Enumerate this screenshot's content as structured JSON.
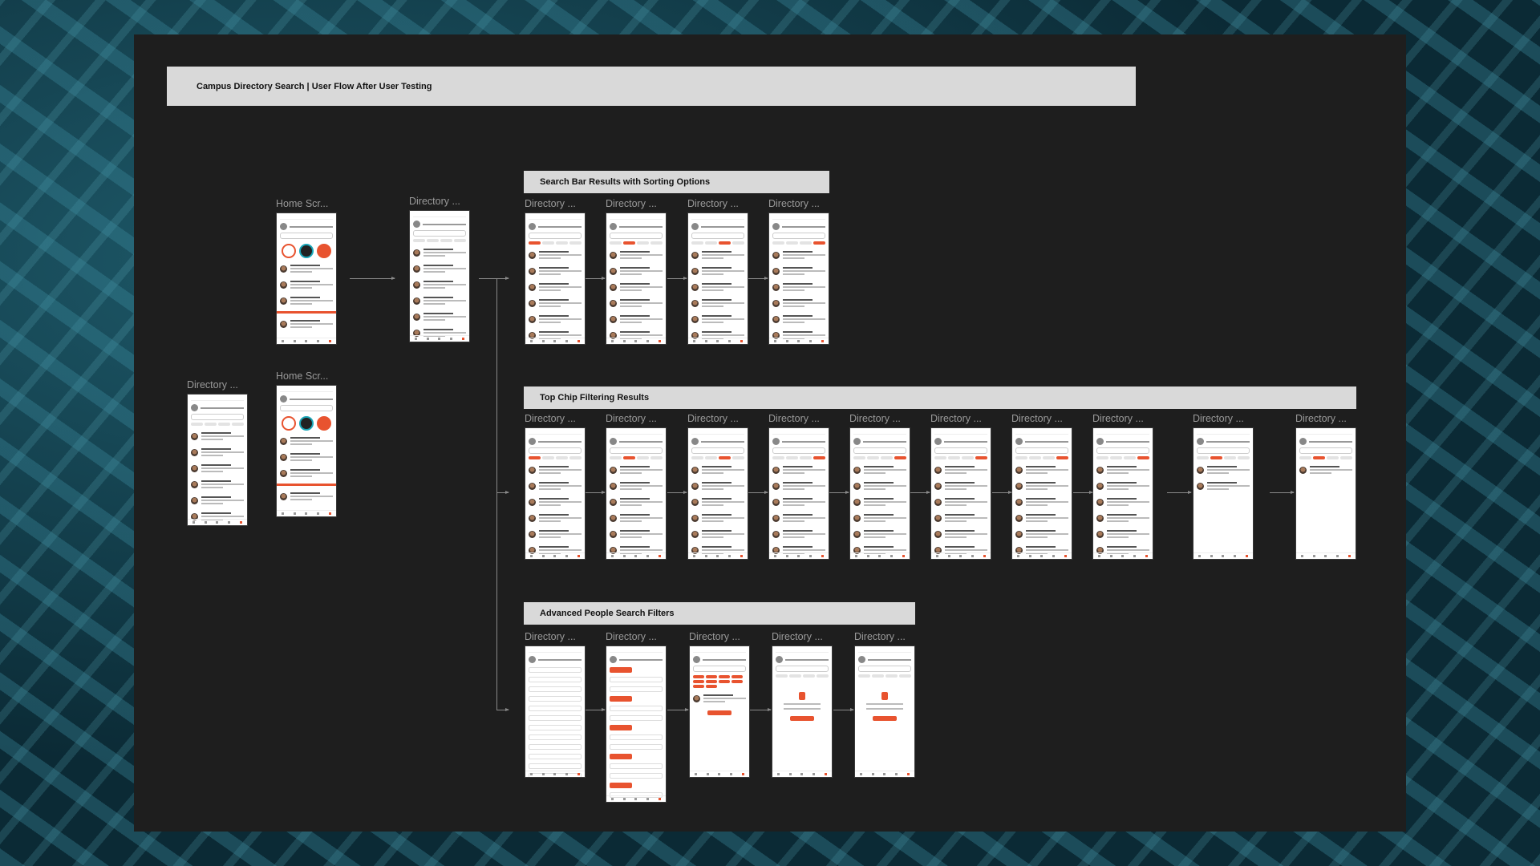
{
  "title": "Campus Directory Search | User Flow After User Testing",
  "sections": {
    "search_bar": "Search Bar Results with Sorting Options",
    "top_chip": "Top Chip Filtering Results",
    "advanced": "Advanced People Search Filters"
  },
  "labels": {
    "home": "Home Scr...",
    "directory": "Directory ..."
  },
  "colors": {
    "accent": "#e8532f",
    "board": "#1e1e1e",
    "bar": "#d9d9d9"
  }
}
